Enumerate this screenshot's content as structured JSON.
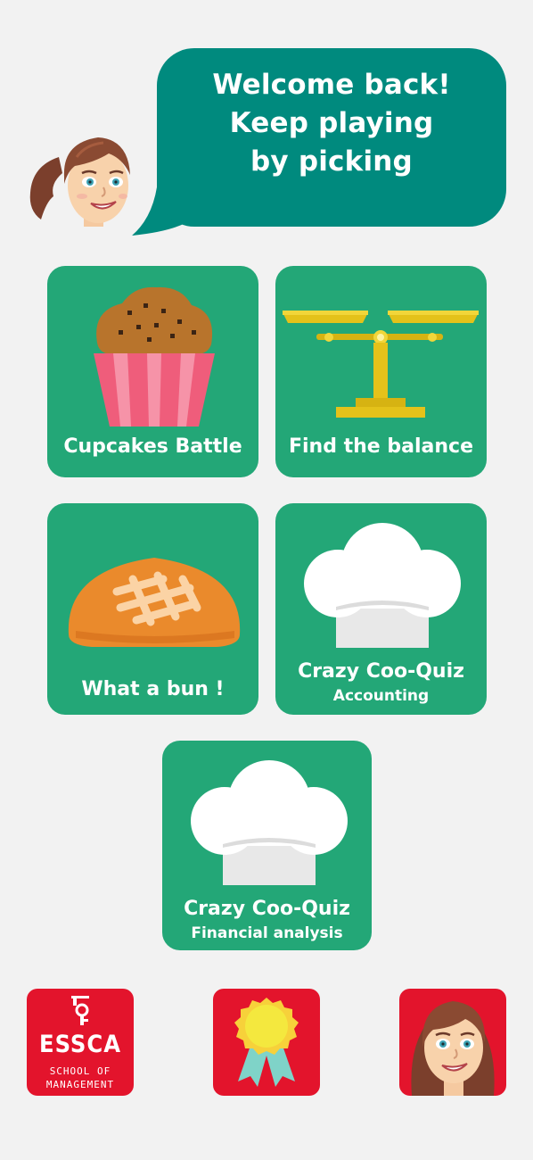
{
  "header": {
    "greeting_lines": [
      "Welcome back!",
      "Keep playing",
      "by picking"
    ],
    "avatar_icon": "woman-character-icon"
  },
  "games": [
    {
      "id": "cupcakes",
      "title": "Cupcakes Battle",
      "subtitle": "",
      "icon": "cupcake-icon"
    },
    {
      "id": "balance",
      "title": "Find the balance",
      "subtitle": "",
      "icon": "balance-scale-icon"
    },
    {
      "id": "bun",
      "title": "What a bun !",
      "subtitle": "",
      "icon": "bread-bun-icon"
    },
    {
      "id": "quiz-accounting",
      "title": "Crazy Coo-Quiz",
      "subtitle": "Accounting",
      "icon": "chef-hat-icon"
    },
    {
      "id": "quiz-financial",
      "title": "Crazy Coo-Quiz",
      "subtitle": "Financial analysis",
      "icon": "chef-hat-icon"
    }
  ],
  "footer": {
    "logo": {
      "name": "ESSCA",
      "line1": "SCHOOL OF",
      "line2": "MANAGEMENT",
      "icon": "essca-key-logo-icon"
    },
    "award_icon": "award-ribbon-icon",
    "profile_icon": "woman-character-icon"
  },
  "colors": {
    "background": "#f2f2f2",
    "bubble": "#008a7e",
    "tile": "#23a777",
    "footer_button": "#e3142c"
  }
}
